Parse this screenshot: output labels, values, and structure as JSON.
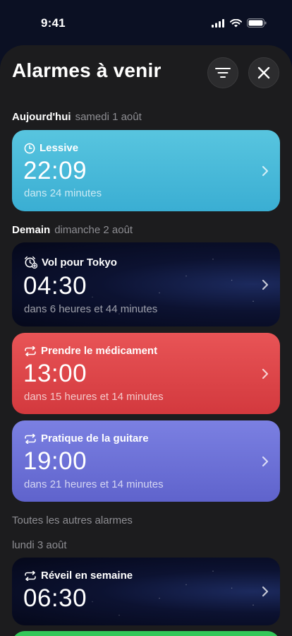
{
  "status": {
    "time": "9:41"
  },
  "header": {
    "title": "Alarmes à venir"
  },
  "sections": {
    "today": {
      "label": "Aujourd'hui",
      "date": "samedi 1 août"
    },
    "tomorrow": {
      "label": "Demain",
      "date": "dimanche 2 août"
    },
    "others": {
      "label": "Toutes les autres alarmes"
    },
    "monday": {
      "label": "lundi 3 août"
    }
  },
  "alarms": [
    {
      "name": "Lessive",
      "time": "22:09",
      "countdown": "dans 24 minutes",
      "icon": "clock-icon",
      "style": "teal",
      "color": "#45b8d8"
    },
    {
      "name": "Vol pour Tokyo",
      "time": "04:30",
      "countdown": "dans 6 heures et 44 minutes",
      "icon": "alarm-clock-icon",
      "style": "night"
    },
    {
      "name": "Prendre le médicament",
      "time": "13:00",
      "countdown": "dans 15 heures et 14 minutes",
      "icon": "repeat-icon",
      "style": "red",
      "color": "#dd4a4d"
    },
    {
      "name": "Pratique de la guitare",
      "time": "19:00",
      "countdown": "dans 21 heures et 14 minutes",
      "icon": "repeat-icon",
      "style": "purple",
      "color": "#6b70d8"
    },
    {
      "name": "Réveil en semaine",
      "time": "06:30",
      "countdown": "",
      "icon": "repeat-icon",
      "style": "night"
    }
  ]
}
